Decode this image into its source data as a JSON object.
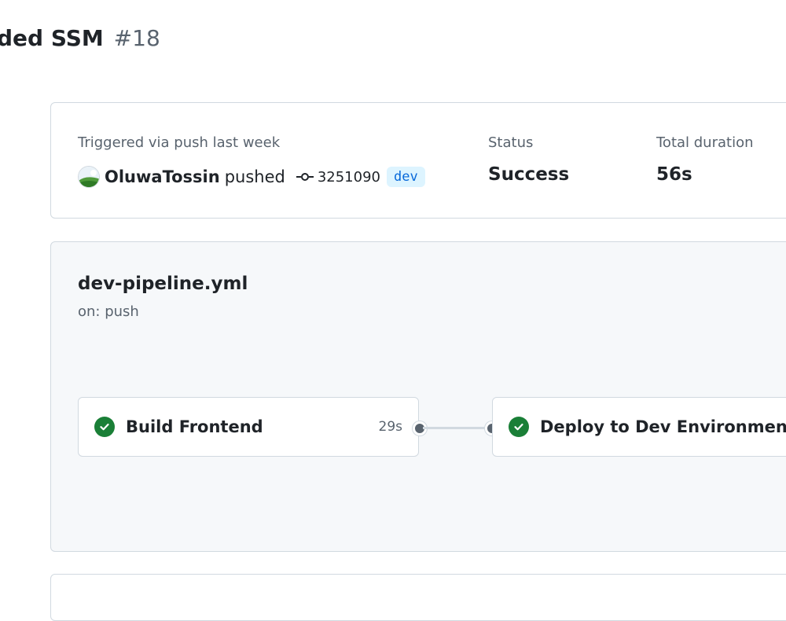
{
  "header": {
    "title": "ded SSM",
    "run_number": "#18"
  },
  "summary": {
    "trigger_label": "Triggered via push last week",
    "actor": "OluwaTossin",
    "verb": "pushed",
    "commit_sha": "3251090",
    "branch": "dev",
    "status_label": "Status",
    "status_value": "Success",
    "duration_label": "Total duration",
    "duration_value": "56s"
  },
  "workflow": {
    "file": "dev-pipeline.yml",
    "trigger": "on: push",
    "jobs": [
      {
        "name": "Build Frontend",
        "duration": "29s",
        "status": "success"
      },
      {
        "name": "Deploy to Dev Environment",
        "duration": "",
        "status": "success"
      }
    ]
  },
  "icons": {
    "commit": "git-commit-icon",
    "status": "check-circle-fill-icon"
  },
  "colors": {
    "success": "#1a7f37",
    "branch_bg": "#ddf4ff",
    "branch_fg": "#0969da",
    "muted": "#59636e",
    "border": "#d1d9e0"
  }
}
